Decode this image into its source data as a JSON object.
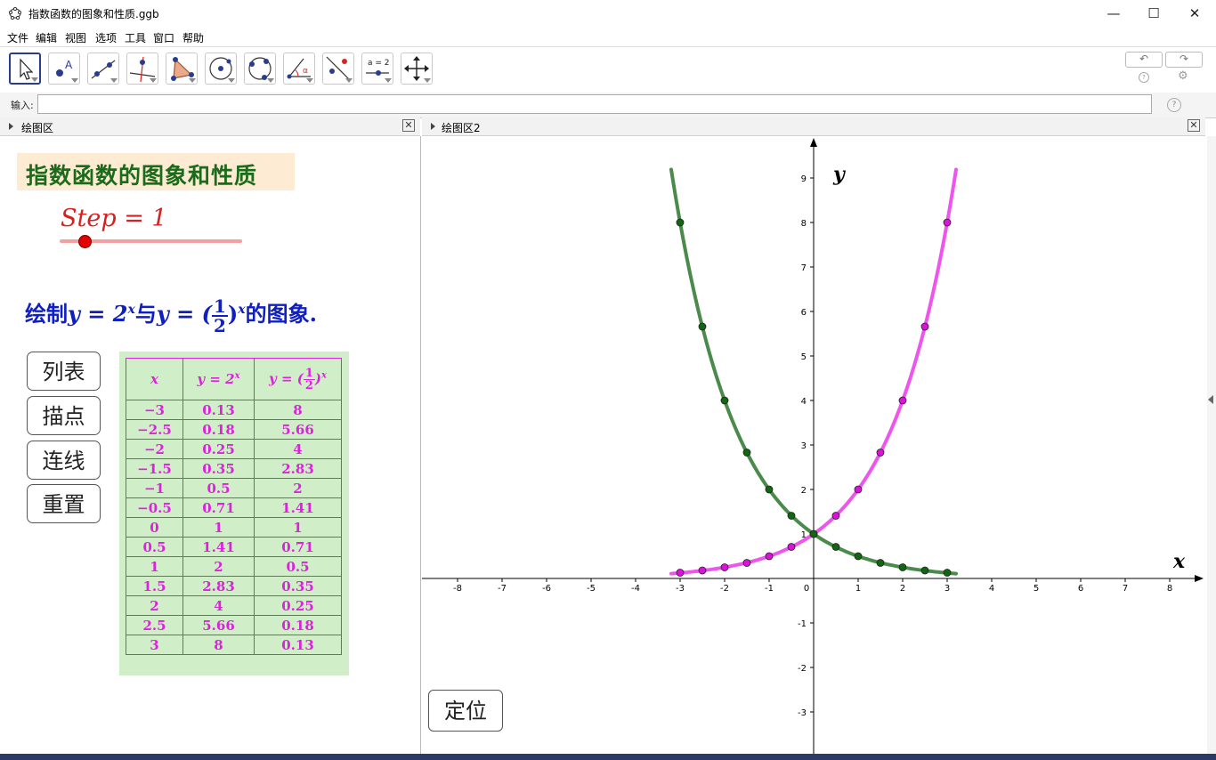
{
  "window": {
    "title": "指数函数的图象和性质.ggb",
    "icon": "geogebra-icon"
  },
  "menu": [
    "文件",
    "编辑",
    "视图",
    "选项",
    "工具",
    "窗口",
    "帮助"
  ],
  "toolbar": {
    "tools": [
      "move-tool",
      "point-tool",
      "line-tool",
      "perpendicular-line-tool",
      "polygon-tool",
      "circle-tool",
      "circle-through-points-tool",
      "angle-tool",
      "reflect-tool",
      "slider-tool",
      "move-graphics-view-tool"
    ],
    "slider_tool_label": "a = 2"
  },
  "input_bar": {
    "label": "输入:",
    "value": "",
    "help": "?"
  },
  "panels": {
    "left_title": "绘图区",
    "right_title": "绘图区2"
  },
  "left": {
    "heading": "指数函数的图象和性质",
    "step_label": "Step = 1",
    "step_value": 1,
    "task_prefix": "绘制",
    "task_f1": "y = 2",
    "task_sup": "x",
    "task_mid": "与",
    "task_f2": "y = (",
    "frac_num": "1",
    "frac_den": "2",
    "task_close": ")",
    "task_suffix": "的图象.",
    "buttons": [
      "列表",
      "描点",
      "连线",
      "重置"
    ],
    "table": {
      "headers": [
        "x",
        "y = 2",
        "y = ("
      ],
      "rows": [
        [
          "−3",
          "0.13",
          "8"
        ],
        [
          "−2.5",
          "0.18",
          "5.66"
        ],
        [
          "−2",
          "0.25",
          "4"
        ],
        [
          "−1.5",
          "0.35",
          "2.83"
        ],
        [
          "−1",
          "0.5",
          "2"
        ],
        [
          "−0.5",
          "0.71",
          "1.41"
        ],
        [
          "0",
          "1",
          "1"
        ],
        [
          "0.5",
          "1.41",
          "0.71"
        ],
        [
          "1",
          "2",
          "0.5"
        ],
        [
          "1.5",
          "2.83",
          "0.35"
        ],
        [
          "2",
          "4",
          "0.25"
        ],
        [
          "2.5",
          "5.66",
          "0.18"
        ],
        [
          "3",
          "8",
          "0.13"
        ]
      ]
    }
  },
  "graph": {
    "x_label": "x",
    "y_label": "y",
    "locate_button": "定位",
    "x_ticks": [
      "-8",
      "-7",
      "-6",
      "-5",
      "-4",
      "-3",
      "-2",
      "-1",
      "0",
      "1",
      "2",
      "3",
      "4",
      "5",
      "6",
      "7",
      "8"
    ],
    "y_ticks": [
      "-3",
      "-2",
      "-1",
      "1",
      "2",
      "3",
      "4",
      "5",
      "6",
      "7",
      "8",
      "9"
    ],
    "colors": {
      "growth": "#ee55ee",
      "decay": "#4a8a4a",
      "growth_point": "#dd11dd",
      "decay_point": "#116611"
    }
  },
  "chart_data": {
    "type": "line",
    "xlim": [
      -8.8,
      8.8
    ],
    "ylim": [
      -3.9,
      9.9
    ],
    "series": [
      {
        "name": "y = 2^x",
        "x": [
          -3,
          -2.5,
          -2,
          -1.5,
          -1,
          -0.5,
          0,
          0.5,
          1,
          1.5,
          2,
          2.5,
          3
        ],
        "y": [
          0.13,
          0.18,
          0.25,
          0.35,
          0.5,
          0.71,
          1,
          1.41,
          2,
          2.83,
          4,
          5.66,
          8
        ]
      },
      {
        "name": "y = (1/2)^x",
        "x": [
          -3,
          -2.5,
          -2,
          -1.5,
          -1,
          -0.5,
          0,
          0.5,
          1,
          1.5,
          2,
          2.5,
          3
        ],
        "y": [
          8,
          5.66,
          4,
          2.83,
          2,
          1.41,
          1,
          0.71,
          0.5,
          0.35,
          0.25,
          0.18,
          0.13
        ]
      }
    ]
  }
}
